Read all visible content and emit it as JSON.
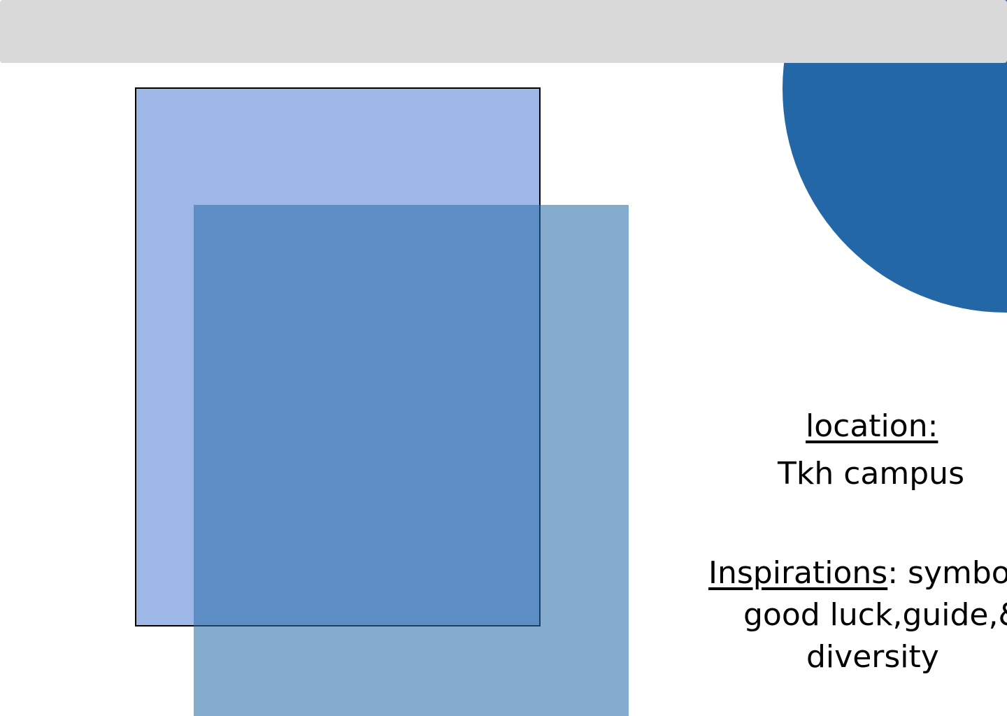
{
  "colors": {
    "top_bar": "#d9d9d9",
    "circle": "#2367a6",
    "rect_back": "#9db7e6",
    "rect_front": "#2d6fad",
    "text": "#000000"
  },
  "info": {
    "location_label": "location:",
    "location_value": "Tkh campus",
    "inspirations_label": "Inspirations",
    "inspirations_line1_rest": ": symbol of",
    "inspirations_line2": "good luck,guide,&",
    "inspirations_line3": "diversity"
  }
}
